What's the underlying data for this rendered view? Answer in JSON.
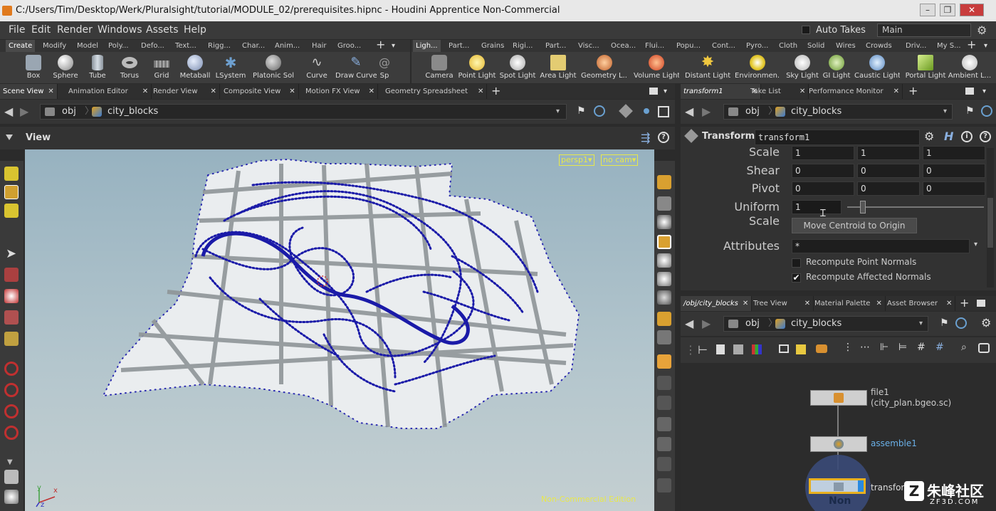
{
  "window": {
    "title": "C:/Users/Tim/Desktop/Werk/Pluralsight/tutorial/MODULE_02/prerequisites.hipnc - Houdini Apprentice Non-Commercial",
    "icon": "houdini-app-icon",
    "controls": [
      "minimize",
      "restore",
      "close"
    ]
  },
  "menubar": {
    "items": [
      "File",
      "Edit",
      "Render",
      "Windows",
      "Assets",
      "Help"
    ],
    "auto_takes": "Auto Takes",
    "desktop": "Main"
  },
  "shelf_left": {
    "tabs": [
      "Create",
      "Modify",
      "Model",
      "Poly...",
      "Defo...",
      "Text...",
      "Rigg...",
      "Char...",
      "Anim...",
      "Hair",
      "Groo..."
    ],
    "tools": [
      {
        "label": "Box",
        "icon": "box-icon",
        "color": "#9aa6b2"
      },
      {
        "label": "Sphere",
        "icon": "sphere-icon",
        "color": "#c8c8c8"
      },
      {
        "label": "Tube",
        "icon": "tube-icon",
        "color": "#a9b3bd"
      },
      {
        "label": "Torus",
        "icon": "torus-icon",
        "color": "#b9b9b9"
      },
      {
        "label": "Grid",
        "icon": "grid-icon",
        "color": "#8c8c8c"
      },
      {
        "label": "Metaball",
        "icon": "metaball-icon",
        "color": "#9db0d0"
      },
      {
        "label": "LSystem",
        "icon": "lsystem-icon",
        "color": "#6b8fb0"
      },
      {
        "label": "Platonic Sol...",
        "icon": "platonic-icon",
        "color": "#a8a8a8"
      },
      {
        "label": "Curve",
        "icon": "curve-icon",
        "color": "#c9c9a0"
      },
      {
        "label": "Draw Curve",
        "icon": "draw-curve-icon",
        "color": "#7aa0d0"
      },
      {
        "label": "Sp",
        "icon": "spiral-icon",
        "color": "#999999"
      }
    ]
  },
  "shelf_right": {
    "tabs": [
      "Ligh...",
      "Part...",
      "Grains",
      "Rigi...",
      "Part...",
      "Visc...",
      "Ocea...",
      "Flui...",
      "Popu...",
      "Cont...",
      "Pyro...",
      "Cloth",
      "Solid",
      "Wires",
      "Crowds",
      "Driv...",
      "My S..."
    ],
    "tools": [
      {
        "label": "Camera",
        "icon": "camera-icon",
        "color": "#9a9a9a"
      },
      {
        "label": "Point Light",
        "icon": "point-light-icon",
        "color": "#f2d25a"
      },
      {
        "label": "Spot Light",
        "icon": "spot-light-icon",
        "color": "#e9e9e9"
      },
      {
        "label": "Area Light",
        "icon": "area-light-icon",
        "color": "#e8d27a"
      },
      {
        "label": "Geometry L...",
        "icon": "geometry-light-icon",
        "color": "#d88a4a"
      },
      {
        "label": "Volume Light",
        "icon": "volume-light-icon",
        "color": "#e06a3a"
      },
      {
        "label": "Distant Light",
        "icon": "distant-light-icon",
        "color": "#f0c840"
      },
      {
        "label": "Environmen...",
        "icon": "environment-light-icon",
        "color": "#e8d040"
      },
      {
        "label": "Sky Light",
        "icon": "sky-light-icon",
        "color": "#d8d8d8"
      },
      {
        "label": "GI Light",
        "icon": "gi-light-icon",
        "color": "#98c060"
      },
      {
        "label": "Caustic Light",
        "icon": "caustic-light-icon",
        "color": "#80a8d0"
      },
      {
        "label": "Portal Light",
        "icon": "portal-light-icon",
        "color": "#a0c040"
      },
      {
        "label": "Ambient L...",
        "icon": "ambient-light-icon",
        "color": "#e0e0e0"
      }
    ]
  },
  "left_pane": {
    "tabs": [
      "Scene View",
      "Animation Editor",
      "Render View",
      "Composite View",
      "Motion FX View",
      "Geometry Spreadsheet"
    ],
    "path": [
      "obj",
      "city_blocks"
    ],
    "viewer_label": "View",
    "camera_menu": "persp1▾",
    "cam_menu": "no cam▾",
    "watermark": "Non-Commercial Edition",
    "axis_labels": [
      "x",
      "y",
      "z"
    ]
  },
  "param_pane": {
    "tabs": [
      "transform1",
      "Take List",
      "Performance Monitor"
    ],
    "path": [
      "obj",
      "city_blocks"
    ],
    "node_type": "Transform",
    "node_name": "transform1",
    "rows": [
      {
        "label": "Scale",
        "values": [
          "1",
          "1",
          "1"
        ]
      },
      {
        "label": "Shear",
        "values": [
          "0",
          "0",
          "0"
        ]
      },
      {
        "label": "Pivot",
        "values": [
          "0",
          "0",
          "0"
        ]
      }
    ],
    "uniform_scale_label": "Uniform Scale",
    "uniform_scale_value": "1",
    "uniform_scale_fraction": 0.1,
    "move_centroid_button": "Move Centroid to Origin",
    "attributes_label": "Attributes",
    "attributes_value": "*",
    "recompute_point_normals": "Recompute Point Normals",
    "recompute_point_normals_checked": false,
    "recompute_affected_normals": "Recompute Affected Normals",
    "recompute_affected_normals_checked": true
  },
  "network_pane": {
    "tabs": [
      "/obj/city_blocks",
      "Tree View",
      "Material Palette",
      "Asset Browser"
    ],
    "path": [
      "obj",
      "city_blocks"
    ],
    "nodes": [
      {
        "name": "file1",
        "detail": "(city_plan.bgeo.sc)"
      },
      {
        "name": "assemble1",
        "detail": ""
      },
      {
        "name": "transform",
        "detail": ""
      }
    ],
    "bottom_text": "Non"
  },
  "logo": {
    "text": "朱峰社区",
    "sub": "ZF3D.COM"
  },
  "colors": {
    "accent": "#e8a33a",
    "points": "#1a1aa8",
    "yellow": "#e8e84a"
  }
}
